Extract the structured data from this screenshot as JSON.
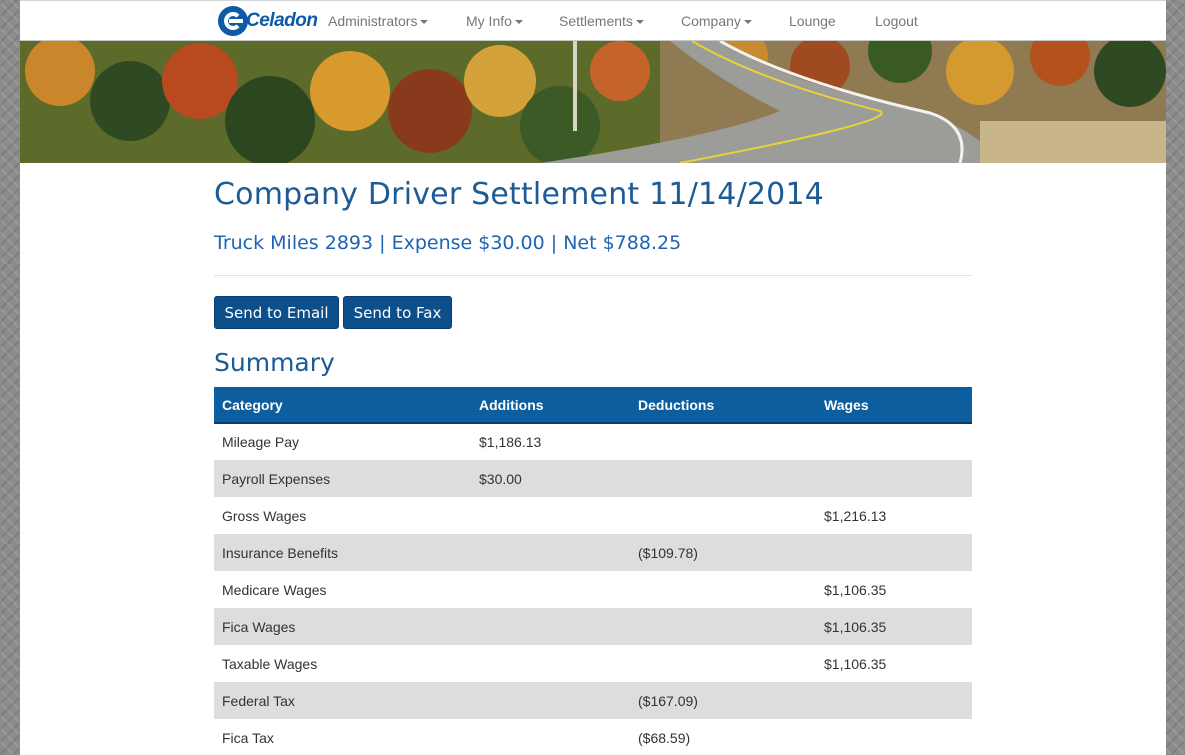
{
  "nav": {
    "logo_text": "Celadon",
    "items": [
      {
        "label": "Administrators",
        "dropdown": true
      },
      {
        "label": "My Info",
        "dropdown": true
      },
      {
        "label": "Settlements",
        "dropdown": true
      },
      {
        "label": "Company",
        "dropdown": true
      },
      {
        "label": "Lounge",
        "dropdown": false
      },
      {
        "label": "Logout",
        "dropdown": false
      }
    ]
  },
  "page": {
    "title": "Company Driver Settlement 11/14/2014",
    "subtitle": "Truck Miles 2893 | Expense $30.00 | Net $788.25",
    "buttons": {
      "email": "Send to Email",
      "fax": "Send to Fax"
    },
    "section_title": "Summary"
  },
  "table": {
    "headers": [
      "Category",
      "Additions",
      "Deductions",
      "Wages"
    ],
    "rows": [
      {
        "category": "Mileage Pay",
        "additions": "$1,186.13",
        "deductions": "",
        "wages": ""
      },
      {
        "category": "Payroll Expenses",
        "additions": "$30.00",
        "deductions": "",
        "wages": ""
      },
      {
        "category": "Gross Wages",
        "additions": "",
        "deductions": "",
        "wages": "$1,216.13"
      },
      {
        "category": "Insurance Benefits",
        "additions": "",
        "deductions": "($109.78)",
        "wages": ""
      },
      {
        "category": "Medicare Wages",
        "additions": "",
        "deductions": "",
        "wages": "$1,106.35"
      },
      {
        "category": "Fica Wages",
        "additions": "",
        "deductions": "",
        "wages": "$1,106.35"
      },
      {
        "category": "Taxable Wages",
        "additions": "",
        "deductions": "",
        "wages": "$1,106.35"
      },
      {
        "category": "Federal Tax",
        "additions": "",
        "deductions": "($167.09)",
        "wages": ""
      },
      {
        "category": "Fica Tax",
        "additions": "",
        "deductions": "($68.59)",
        "wages": ""
      }
    ]
  },
  "colors": {
    "brand": "#0d5aa7",
    "header_bg": "#0d5e9e",
    "button_bg": "#0d4f8b",
    "title": "#1c5b96",
    "stripe": "#dddddd"
  }
}
